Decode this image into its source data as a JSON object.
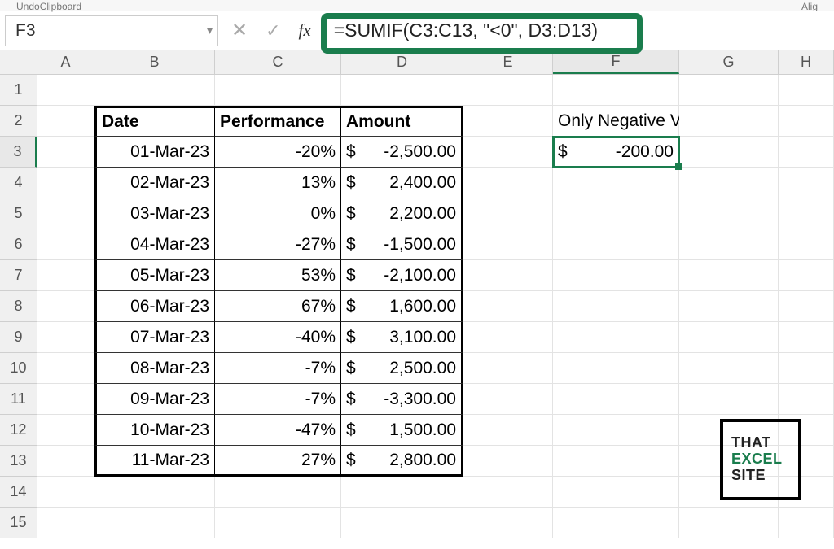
{
  "ribbon": {
    "undo": "Undo",
    "clipboard": "Clipboard",
    "align": "Alig"
  },
  "namebox": {
    "value": "F3"
  },
  "fx": {
    "label": "fx"
  },
  "formula": {
    "text": "=SUMIF(C3:C13, \"<0\", D3:D13)"
  },
  "col_headers": [
    "A",
    "B",
    "C",
    "D",
    "E",
    "F",
    "G",
    "H"
  ],
  "table_headers": {
    "date": "Date",
    "perf": "Performance",
    "amount": "Amount"
  },
  "label_negative": "Only Negative Values:",
  "result": {
    "sym": "$",
    "val": "-200.00"
  },
  "rows": [
    {
      "date": "01-Mar-23",
      "perf": "-20%",
      "sym": "$",
      "amt": "-2,500.00"
    },
    {
      "date": "02-Mar-23",
      "perf": "13%",
      "sym": "$",
      "amt": "2,400.00"
    },
    {
      "date": "03-Mar-23",
      "perf": "0%",
      "sym": "$",
      "amt": "2,200.00"
    },
    {
      "date": "04-Mar-23",
      "perf": "-27%",
      "sym": "$",
      "amt": "-1,500.00"
    },
    {
      "date": "05-Mar-23",
      "perf": "53%",
      "sym": "$",
      "amt": "-2,100.00"
    },
    {
      "date": "06-Mar-23",
      "perf": "67%",
      "sym": "$",
      "amt": "1,600.00"
    },
    {
      "date": "07-Mar-23",
      "perf": "-40%",
      "sym": "$",
      "amt": "3,100.00"
    },
    {
      "date": "08-Mar-23",
      "perf": "-7%",
      "sym": "$",
      "amt": "2,500.00"
    },
    {
      "date": "09-Mar-23",
      "perf": "-7%",
      "sym": "$",
      "amt": "-3,300.00"
    },
    {
      "date": "10-Mar-23",
      "perf": "-47%",
      "sym": "$",
      "amt": "1,500.00"
    },
    {
      "date": "11-Mar-23",
      "perf": "27%",
      "sym": "$",
      "amt": "2,800.00"
    }
  ],
  "watermark": {
    "l1": "THAT",
    "l2": "EXCEL",
    "l3": "SITE"
  }
}
